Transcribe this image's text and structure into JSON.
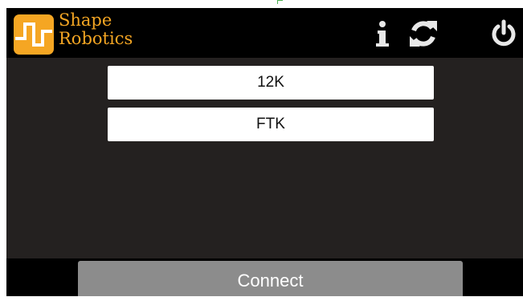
{
  "header": {
    "brand_line1": "Shape",
    "brand_line2": "Robotics",
    "logo_icon": "waveform-logo-icon",
    "info_icon": "info-icon",
    "refresh_icon": "refresh-icon",
    "power_icon": "power-icon"
  },
  "devices": [
    {
      "label": "12K"
    },
    {
      "label": "FTK"
    }
  ],
  "connect_label": "Connect",
  "colors": {
    "brand": "#f5a623",
    "background": "#000000",
    "panel": "#242120",
    "button": "#8c8c8c"
  }
}
